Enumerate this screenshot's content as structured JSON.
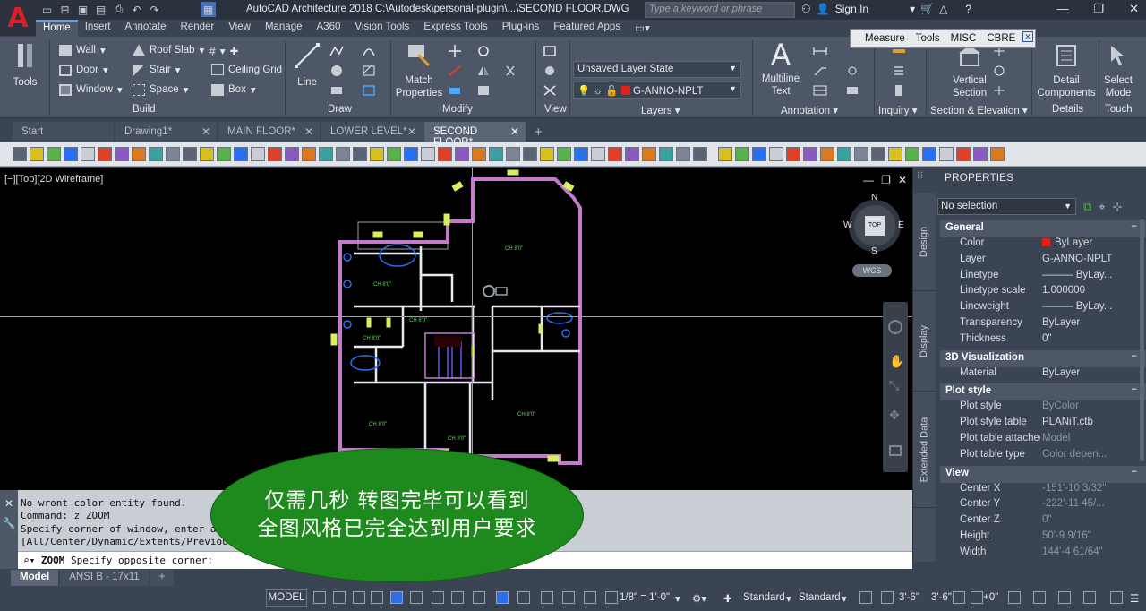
{
  "app": {
    "logo_letter": "A",
    "title": "AutoCAD Architecture 2018   C:\\Autodesk\\personal-plugin\\...\\SECOND FLOOR.DWG",
    "search_placeholder": "Type a keyword or phrase",
    "sign_in": "Sign In"
  },
  "ribbon": {
    "tabs": [
      "Home",
      "Insert",
      "Annotate",
      "Render",
      "View",
      "Manage",
      "A360",
      "Vision Tools",
      "Express Tools",
      "Plug-ins",
      "Featured Apps"
    ],
    "active_tab": "Home",
    "tools_label": "Tools",
    "build": {
      "wall": "Wall",
      "door": "Door",
      "window": "Window",
      "roof_slab": "Roof Slab",
      "stair": "Stair",
      "space": "Space",
      "ceiling_grid": "Ceiling Grid",
      "box": "Box",
      "panel": "Build"
    },
    "draw": {
      "line": "Line",
      "panel": "Draw"
    },
    "modify": {
      "match_properties_1": "Match",
      "match_properties_2": "Properties",
      "panel": "Modify"
    },
    "view_panel": "View",
    "layers": {
      "layer_state": "Unsaved Layer State",
      "current_layer": "G-ANNO-NPLT",
      "panel": "Layers"
    },
    "annotation": {
      "multiline_text_1": "Multiline",
      "multiline_text_2": "Text",
      "panel": "Annotation"
    },
    "inquiry_panel": "Inquiry",
    "section": {
      "vertical_section_1": "Vertical",
      "vertical_section_2": "Section",
      "panel": "Section & Elevation"
    },
    "details": {
      "detail_components_1": "Detail",
      "detail_components_2": "Components",
      "panel": "Details"
    },
    "touch": {
      "select_mode_1": "Select",
      "select_mode_2": "Mode",
      "panel": "Touch"
    }
  },
  "measure_toolbar": {
    "items": [
      "Measure",
      "Tools",
      "MISC",
      "CBRE"
    ]
  },
  "doc_tabs": [
    "Start",
    "Drawing1*",
    "MAIN FLOOR*",
    "LOWER LEVEL*",
    "SECOND FLOOR*"
  ],
  "active_doc_tab": "SECOND FLOOR*",
  "viewport": {
    "label": "[−][Top][2D Wireframe]",
    "viewcube": {
      "top": "TOP",
      "n": "N",
      "s": "S",
      "e": "E",
      "w": "W",
      "wcs": "WCS"
    },
    "plan_labels": {
      "room_1": "CH 8'0\"",
      "room_2": "CH 8'0\"",
      "room_3": "CH 8'0\"",
      "room_4": "CH 8'0\"",
      "room_5": "CH 8'0\"",
      "room_6": "CH 8'0\"",
      "room_7": "CH 8'0\""
    }
  },
  "properties": {
    "title": "PROPERTIES",
    "selection": "No selection",
    "side_tabs": [
      "Design",
      "Display",
      "Extended Data"
    ],
    "sections": [
      {
        "name": "General",
        "rows": [
          {
            "k": "Color",
            "v": "ByLayer",
            "swatch": "#e0201a"
          },
          {
            "k": "Layer",
            "v": "G-ANNO-NPLT"
          },
          {
            "k": "Linetype",
            "v": "——— ByLay..."
          },
          {
            "k": "Linetype scale",
            "v": "1.000000"
          },
          {
            "k": "Lineweight",
            "v": "——— ByLay..."
          },
          {
            "k": "Transparency",
            "v": "ByLayer"
          },
          {
            "k": "Thickness",
            "v": "0\""
          }
        ]
      },
      {
        "name": "3D Visualization",
        "rows": [
          {
            "k": "Material",
            "v": "ByLayer"
          }
        ]
      },
      {
        "name": "Plot style",
        "rows": [
          {
            "k": "Plot style",
            "v": "ByColor",
            "dim": true
          },
          {
            "k": "Plot style table",
            "v": "PLANiT.ctb"
          },
          {
            "k": "Plot table attached...",
            "v": "Model",
            "dim": true
          },
          {
            "k": "Plot table type",
            "v": "Color depen...",
            "dim": true
          }
        ]
      },
      {
        "name": "View",
        "rows": [
          {
            "k": "Center X",
            "v": "-151'-10 3/32\"",
            "dim": true
          },
          {
            "k": "Center Y",
            "v": "-222'-11 45/...",
            "dim": true
          },
          {
            "k": "Center Z",
            "v": "0\"",
            "dim": true
          },
          {
            "k": "Height",
            "v": "50'-9 9/16\"",
            "dim": true
          },
          {
            "k": "Width",
            "v": "144'-4 61/64\"",
            "dim": true
          }
        ]
      }
    ]
  },
  "command": {
    "history": [
      "No wront color entity found.",
      "Command: z ZOOM",
      "Specify corner of window, enter a",
      "[All/Center/Dynamic/Extents/Previou"
    ],
    "input_cmd": "ZOOM",
    "input_text": "Specify opposite corner:"
  },
  "layout_tabs": [
    "Model",
    "ANSI B - 17x11"
  ],
  "status": {
    "model": "MODEL",
    "scale": "1/8\" = 1'-0\"",
    "standard_1": "Standard",
    "standard_2": "Standard",
    "elev_1": "3'-6\"",
    "elev_2": "3'-6\"",
    "offset": "+0\""
  },
  "callout": {
    "line1": "仅需几秒 转图完毕可以看到",
    "line2": "全图风格已完全达到用户要求"
  },
  "colors": {
    "accent_red": "#d8202a",
    "wall_magenta": "#c27ac9",
    "door_yellowgreen": "#d8f060",
    "fixture_blue": "#2a6ef0",
    "callout_green": "#1e8a1e"
  }
}
